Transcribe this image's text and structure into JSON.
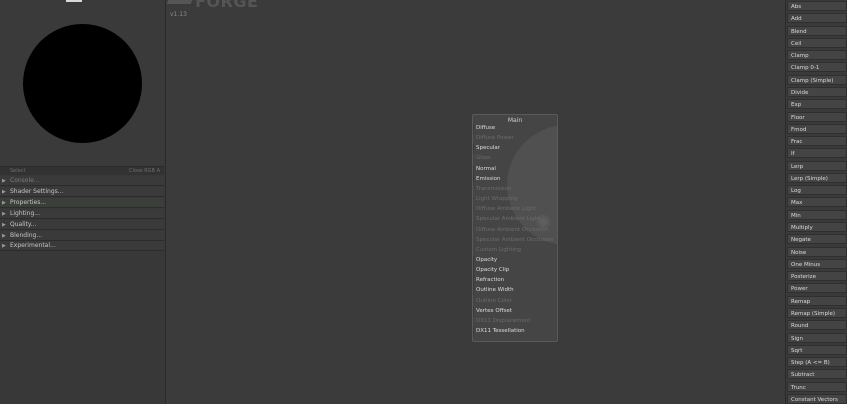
{
  "preview": {
    "status_left": "Select",
    "status_right": "Close RGB A"
  },
  "sections": [
    {
      "label": "Console...",
      "style": "dim"
    },
    {
      "label": "Shader Settings...",
      "style": "normal"
    },
    {
      "label": "Properties...",
      "style": "green"
    },
    {
      "label": "Lighting...",
      "style": "normal"
    },
    {
      "label": "Quality...",
      "style": "normal"
    },
    {
      "label": "Blending...",
      "style": "normal"
    },
    {
      "label": "Experimental...",
      "style": "normal"
    }
  ],
  "canvas": {
    "logo_text": "FORGE",
    "version": "v1.13"
  },
  "main_node": {
    "title": "Main",
    "ports": [
      {
        "label": "Diffuse",
        "enabled": true
      },
      {
        "label": "Diffuse Power",
        "enabled": false
      },
      {
        "label": "Specular",
        "enabled": true
      },
      {
        "label": "Gloss",
        "enabled": false
      },
      {
        "label": "Normal",
        "enabled": true
      },
      {
        "label": "Emission",
        "enabled": true
      },
      {
        "label": "Transmission",
        "enabled": false
      },
      {
        "label": "Light Wrapping",
        "enabled": false
      },
      {
        "label": "Diffuse Ambient Light",
        "enabled": false
      },
      {
        "label": "Specular Ambient Light",
        "enabled": false
      },
      {
        "label": "Diffuse Ambient Occlusion",
        "enabled": false
      },
      {
        "label": "Specular Ambient Occlusion",
        "enabled": false
      },
      {
        "label": "Custom Lighting",
        "enabled": false
      },
      {
        "label": "Opacity",
        "enabled": true
      },
      {
        "label": "Opacity Clip",
        "enabled": true
      },
      {
        "label": "Refraction",
        "enabled": true
      },
      {
        "label": "Outline Width",
        "enabled": true
      },
      {
        "label": "Outline Color",
        "enabled": false
      },
      {
        "label": "Vertex Offset",
        "enabled": true
      },
      {
        "label": "DX11 Displacement",
        "enabled": false
      },
      {
        "label": "DX11 Tessellation",
        "enabled": true
      }
    ]
  },
  "node_list": [
    "Abs",
    "Add",
    "Blend",
    "Ceil",
    "Clamp",
    "Clamp 0-1",
    "Clamp (Simple)",
    "Divide",
    "Exp",
    "Floor",
    "Fmod",
    "Frac",
    "If",
    "Lerp",
    "Lerp (Simple)",
    "Log",
    "Max",
    "Min",
    "Multiply",
    "Negate",
    "Noise",
    "One Minus",
    "Posterize",
    "Power",
    "Remap",
    "Remap (Simple)",
    "Round",
    "Sign",
    "Sqrt",
    "Step (A <= B)",
    "Subtract",
    "Trunc",
    "Constant Vectors"
  ]
}
